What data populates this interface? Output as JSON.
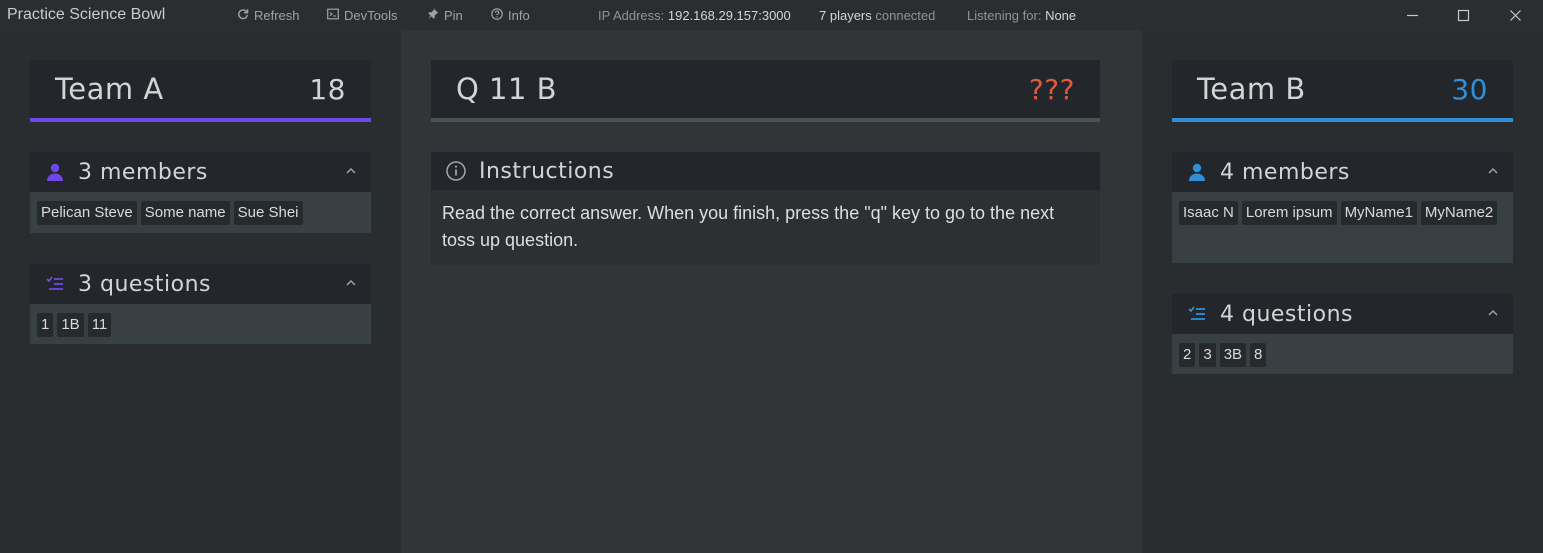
{
  "titlebar": {
    "app_title": "Practice Science Bowl",
    "refresh_label": "Refresh",
    "devtools_label": "DevTools",
    "pin_label": "Pin",
    "info_label": "Info",
    "ip_prefix": "IP Address:",
    "ip_value": "192.168.29.157:3000",
    "players_count": "7 players",
    "players_suffix": "connected",
    "listening_prefix": "Listening for:",
    "listening_value": "None"
  },
  "team_a": {
    "name": "Team A",
    "score": "18",
    "accent": "#7048e8",
    "members_label": "3 members",
    "members": [
      "Pelican Steve",
      "Some name",
      "Sue Shei"
    ],
    "questions_label": "3 questions",
    "questions": [
      "1",
      "1B",
      "11"
    ]
  },
  "question": {
    "label": "Q 11 B",
    "status": "???",
    "status_color": "#e0593a",
    "instructions_title": "Instructions",
    "instructions_text": "Read the correct answer. When you finish, press the \"q\" key to go to the next toss up question."
  },
  "team_b": {
    "name": "Team B",
    "score": "30",
    "accent": "#2f8fd8",
    "members_label": "4 members",
    "members": [
      "Isaac N",
      "Lorem ipsum",
      "MyName1",
      "MyName2"
    ],
    "questions_label": "4 questions",
    "questions": [
      "2",
      "3",
      "3B",
      "8"
    ]
  },
  "icons": {
    "refresh": "refresh-icon",
    "devtools": "terminal-icon",
    "pin": "pin-icon",
    "info": "info-icon",
    "members": "user-icon",
    "questions": "checklist-icon",
    "collapse": "chevron-up-icon",
    "instructions": "info-circle-icon"
  }
}
